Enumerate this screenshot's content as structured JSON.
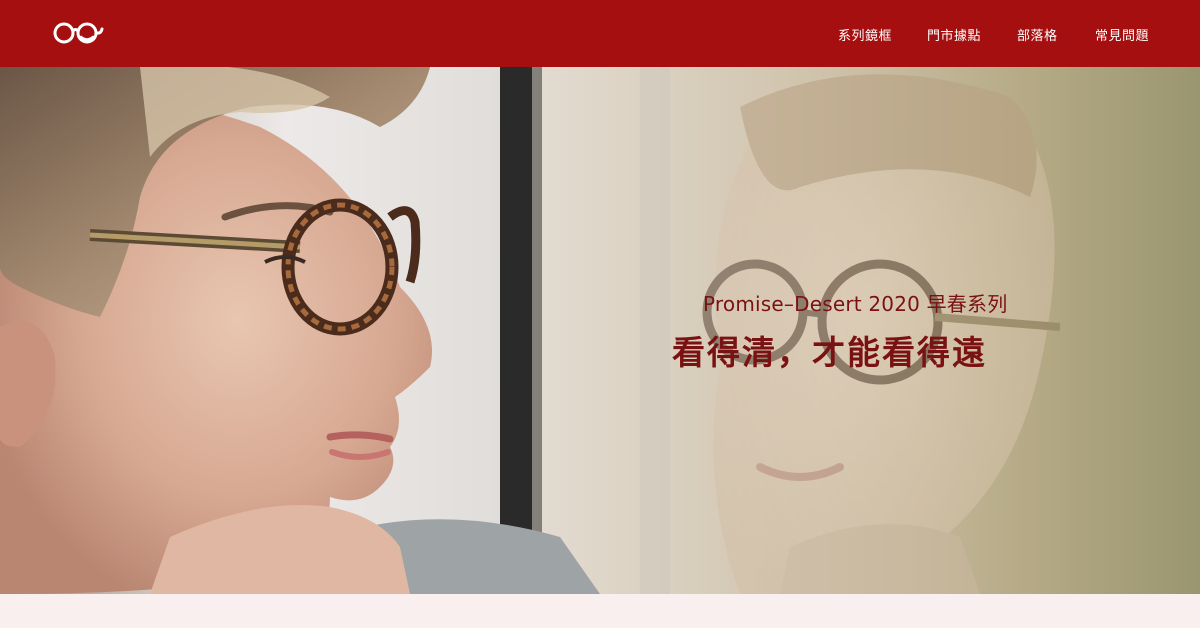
{
  "header": {
    "background_color": "#a50f10",
    "logo_icon": "glasses-logo-icon",
    "nav_items": [
      {
        "label": "系列鏡框"
      },
      {
        "label": "門市據點"
      },
      {
        "label": "部落格"
      },
      {
        "label": "常見問題"
      }
    ]
  },
  "hero": {
    "subtitle": "Promise–Desert 2020 早春系列",
    "title": "看得清，才能看得遠",
    "text_color": "#7a1214"
  },
  "footer_strip": {
    "background_color": "#f9efee"
  }
}
